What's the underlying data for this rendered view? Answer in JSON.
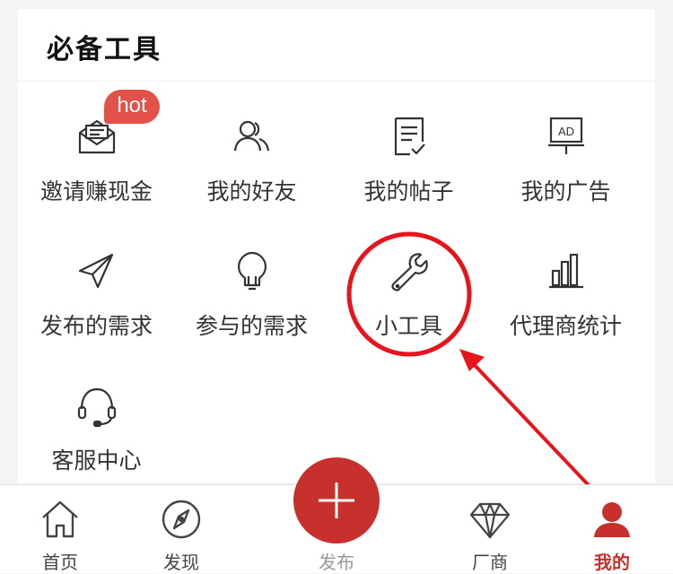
{
  "section": {
    "title": "必备工具"
  },
  "tools": [
    {
      "label": "邀请赚现金",
      "icon": "envelope-invite-icon"
    },
    {
      "label": "我的好友",
      "icon": "friends-icon"
    },
    {
      "label": "我的帖子",
      "icon": "document-check-icon"
    },
    {
      "label": "我的广告",
      "icon": "ad-board-icon"
    },
    {
      "label": "发布的需求",
      "icon": "paper-plane-icon"
    },
    {
      "label": "参与的需求",
      "icon": "lightbulb-icon"
    },
    {
      "label": "小工具",
      "icon": "wrench-icon"
    },
    {
      "label": "代理商统计",
      "icon": "bar-chart-icon"
    },
    {
      "label": "客服中心",
      "icon": "headset-icon"
    }
  ],
  "badge": {
    "hot": "hot"
  },
  "tabbar": [
    {
      "label": "首页",
      "icon": "home-icon"
    },
    {
      "label": "发现",
      "icon": "compass-icon"
    },
    {
      "label": "发布",
      "icon": "plus-icon"
    },
    {
      "label": "厂商",
      "icon": "diamond-icon"
    },
    {
      "label": "我的",
      "icon": "user-icon",
      "active": true
    }
  ],
  "colors": {
    "accent": "#c8302d",
    "annotation": "#e8141b",
    "hot_badge": "#e25248",
    "active_tab": "#c8302d"
  }
}
